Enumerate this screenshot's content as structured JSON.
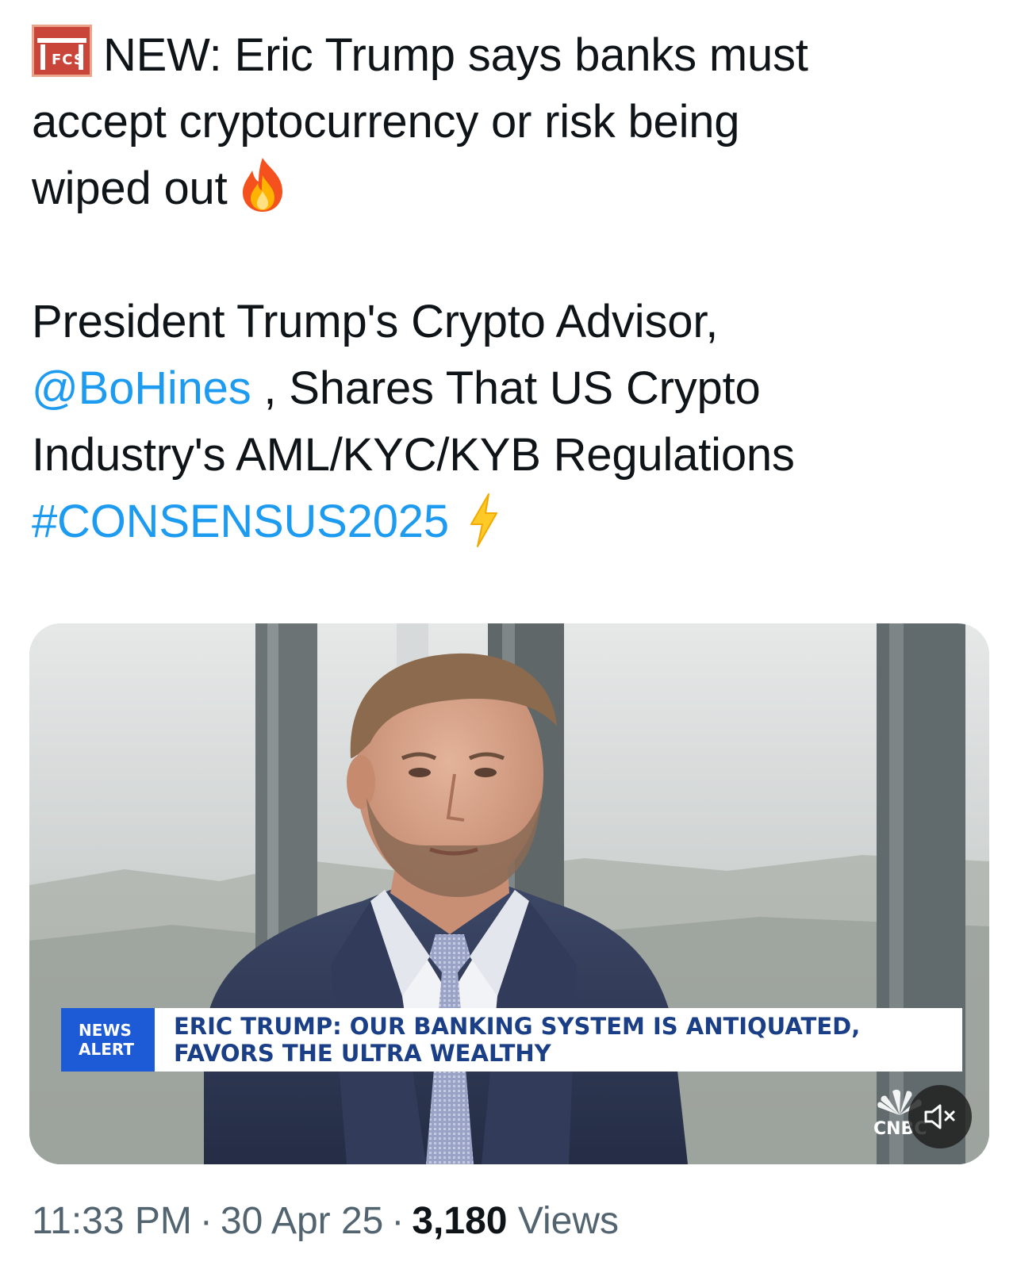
{
  "tweet": {
    "line1": "NEW: Eric Trump says banks must",
    "line2": "accept cryptocurrency or risk being",
    "line3": "wiped out",
    "line4": "President Trump's Crypto Advisor,",
    "mention": "@BoHines",
    "line5_rest": " , Shares That US Crypto",
    "line6": "Industry's AML/KYC/KYB Regulations",
    "hashtag": "#CONSENSUS2025",
    "badge_text": "FCS",
    "icons": {
      "badge": "flag-badge-icon",
      "fire": "fire-emoji-icon",
      "bolt": "lightning-emoji-icon"
    }
  },
  "media": {
    "news_alert_line1": "NEWS",
    "news_alert_line2": "ALERT",
    "headline_line1": "ERIC TRUMP: OUR BANKING SYSTEM IS ANTIQUATED,",
    "headline_line2": "FAVORS THE ULTRA WEALTHY",
    "logo_text": "CNBC",
    "mute_icon": "speaker-muted-icon"
  },
  "meta": {
    "time": "11:33 PM",
    "separator": "·",
    "date": "30 Apr 25",
    "views_count": "3,180",
    "views_label": "Views"
  },
  "colors": {
    "link": "#1d9bf0",
    "news_alert_bg": "#1c5ad6",
    "headline_text": "#1b3f86",
    "meta_text": "#536471"
  }
}
